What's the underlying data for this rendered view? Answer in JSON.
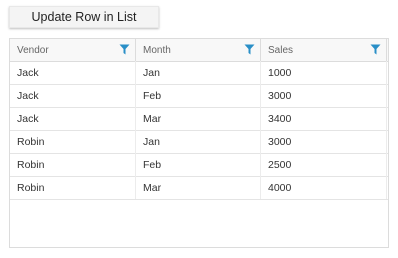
{
  "toolbar": {
    "update_button_label": "Update Row in List"
  },
  "grid": {
    "columns": [
      {
        "label": "Vendor",
        "filter_icon": "filter-icon"
      },
      {
        "label": "Month",
        "filter_icon": "filter-icon"
      },
      {
        "label": "Sales",
        "filter_icon": "filter-icon"
      }
    ],
    "rows": [
      [
        "Jack",
        "Jan",
        "1000"
      ],
      [
        "Jack",
        "Feb",
        "3000"
      ],
      [
        "Jack",
        "Mar",
        "3400"
      ],
      [
        "Robin",
        "Jan",
        "3000"
      ],
      [
        "Robin",
        "Feb",
        "2500"
      ],
      [
        "Robin",
        "Mar",
        "4000"
      ]
    ]
  },
  "colors": {
    "filter_icon": "#2a8fc7",
    "header_background": "#f8f8f8",
    "border": "#dcdcdc"
  }
}
